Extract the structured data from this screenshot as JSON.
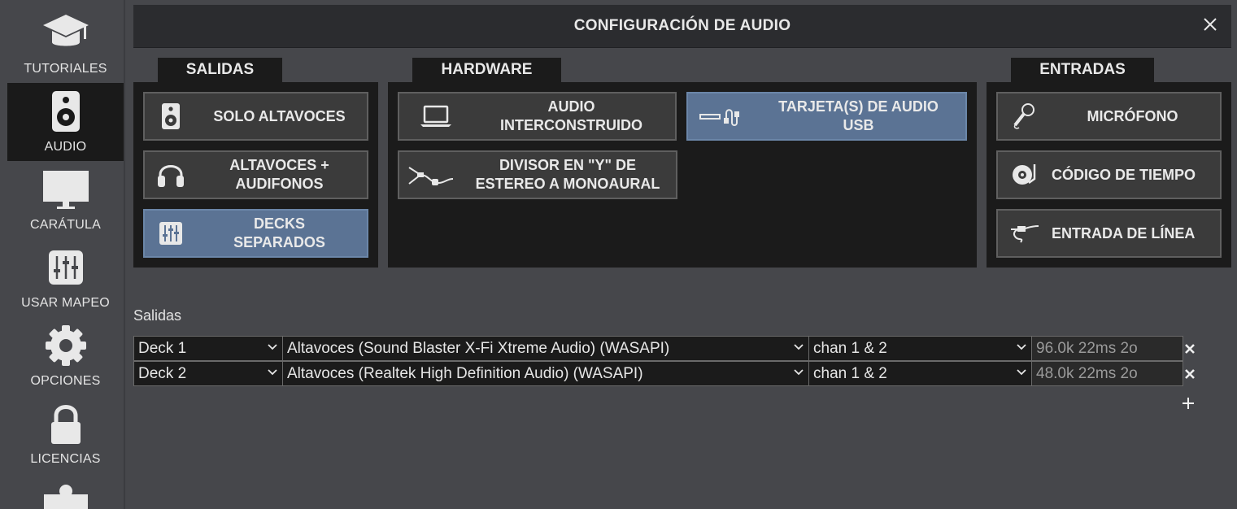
{
  "sidebar": {
    "items": [
      {
        "label": "TUTORIALES",
        "icon": "graduation-cap-icon"
      },
      {
        "label": "AUDIO",
        "icon": "speaker-icon",
        "active": true
      },
      {
        "label": "CARÁTULA",
        "icon": "monitor-icon"
      },
      {
        "label": "USAR MAPEO",
        "icon": "mixer-sliders-icon"
      },
      {
        "label": "OPCIONES",
        "icon": "gear-icon"
      },
      {
        "label": "LICENCIAS",
        "icon": "lock-icon"
      },
      {
        "label": "",
        "icon": "puzzle-icon"
      }
    ]
  },
  "dialog": {
    "title": "CONFIGURACIÓN DE AUDIO",
    "close_icon": "close-icon"
  },
  "salidas": {
    "tab_label": "SALIDAS",
    "options": [
      {
        "label": "SOLO ALTAVOCES",
        "icon": "speaker-icon",
        "selected": false
      },
      {
        "label": "ALTAVOCES +\nAUDIFONOS",
        "icon": "headphones-icon",
        "selected": false
      },
      {
        "label": "DECKS\nSEPARADOS",
        "icon": "mixer-sliders-icon",
        "selected": true
      }
    ]
  },
  "hardware": {
    "tab_label": "HARDWARE",
    "options": [
      {
        "label": "AUDIO\nINTERCONSTRUIDO",
        "icon": "laptop-icon",
        "selected": false
      },
      {
        "label": "TARJETA(S) DE AUDIO\nUSB",
        "icon": "usb-cable-icon",
        "selected": true
      },
      {
        "label": "DIVISOR EN \"Y\" DE\nESTEREO A MONOAURAL",
        "icon": "y-splitter-cable-icon",
        "selected": false
      }
    ]
  },
  "entradas": {
    "tab_label": "ENTRADAS",
    "options": [
      {
        "label": "MICRÓFONO",
        "icon": "microphone-icon",
        "selected": false
      },
      {
        "label": "CÓDIGO DE TIEMPO",
        "icon": "turntable-icon",
        "selected": false
      },
      {
        "label": "ENTRADA DE LÍNEA",
        "icon": "line-cable-icon",
        "selected": false
      }
    ]
  },
  "outputs": {
    "section_label": "Salidas",
    "rows": [
      {
        "deck": "Deck 1",
        "device": "Altavoces (Sound Blaster X-Fi Xtreme Audio) (WASAPI)",
        "channel": "chan 1 & 2",
        "info": "96.0k 22ms 2o"
      },
      {
        "deck": "Deck 2",
        "device": "Altavoces (Realtek High Definition Audio) (WASAPI)",
        "channel": "chan 1 & 2",
        "info": "48.0k 22ms 2o"
      }
    ]
  },
  "colors": {
    "background": "#46474b",
    "panel": "#1b1b1b",
    "button": "#3b3b3b",
    "button_selected": "#5b7394"
  }
}
